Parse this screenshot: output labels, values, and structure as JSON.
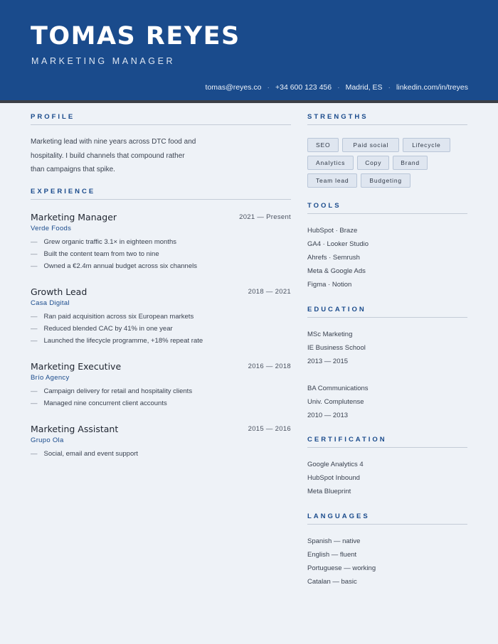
{
  "header": {
    "name": "TOMAS REYES",
    "title": "MARKETING MANAGER",
    "contact": [
      "tomas@reyes.co",
      "+34 600 123 456",
      "Madrid, ES",
      "linkedin.com/in/treyes"
    ],
    "separator": "·"
  },
  "profile": {
    "heading": "PROFILE",
    "lines": [
      "Marketing lead with nine years across DTC food and",
      "hospitality. I build channels that compound rather",
      "than campaigns that spike."
    ]
  },
  "experience": {
    "heading": "EXPERIENCE",
    "dash": "—",
    "jobs": [
      {
        "role": "Marketing Manager",
        "dates": "2021 —  Present",
        "company": "Verde Foods",
        "bullets": [
          "Grew organic traffic 3.1× in eighteen months",
          "Built the content team from two to nine",
          "Owned a €2.4m annual budget across six channels"
        ]
      },
      {
        "role": "Growth Lead",
        "dates": "2018 —  2021",
        "company": "Casa Digital",
        "bullets": [
          "Ran paid acquisition across six European markets",
          "Reduced blended CAC by 41% in one year",
          "Launched the lifecycle programme, +18% repeat rate"
        ]
      },
      {
        "role": "Marketing Executive",
        "dates": "2016 —  2018",
        "company": "Brío Agency",
        "bullets": [
          "Campaign delivery for retail and hospitality clients",
          "Managed nine concurrent client accounts"
        ]
      },
      {
        "role": "Marketing Assistant",
        "dates": "2015 —  2016",
        "company": "Grupo Ola",
        "bullets": [
          "Social, email and event support"
        ]
      }
    ]
  },
  "strengths": {
    "heading": "STRENGTHS",
    "rows": [
      [
        "SEO",
        "Paid social",
        "Lifecycle"
      ],
      [
        "Analytics",
        "Copy",
        "Brand"
      ],
      [
        "Team lead",
        "Budgeting"
      ]
    ]
  },
  "tools": {
    "heading": "TOOLS",
    "items": [
      "HubSpot · Braze",
      "GA4 · Looker Studio",
      "Ahrefs · Semrush",
      "Meta & Google Ads",
      "Figma · Notion"
    ]
  },
  "education": {
    "heading": "EDUCATION",
    "entries": [
      [
        "MSc Marketing",
        "IE Business School",
        "2013 —  2015"
      ],
      [
        "BA Communications",
        "Univ. Complutense",
        "2010 —  2013"
      ]
    ]
  },
  "certification": {
    "heading": "CERTIFICATION",
    "items": [
      "Google Analytics 4",
      "HubSpot Inbound",
      "Meta Blueprint"
    ]
  },
  "languages": {
    "heading": "LANGUAGES",
    "items": [
      "Spanish —  native",
      "English —  fluent",
      "Portuguese —  working",
      "Catalan —  basic"
    ]
  }
}
